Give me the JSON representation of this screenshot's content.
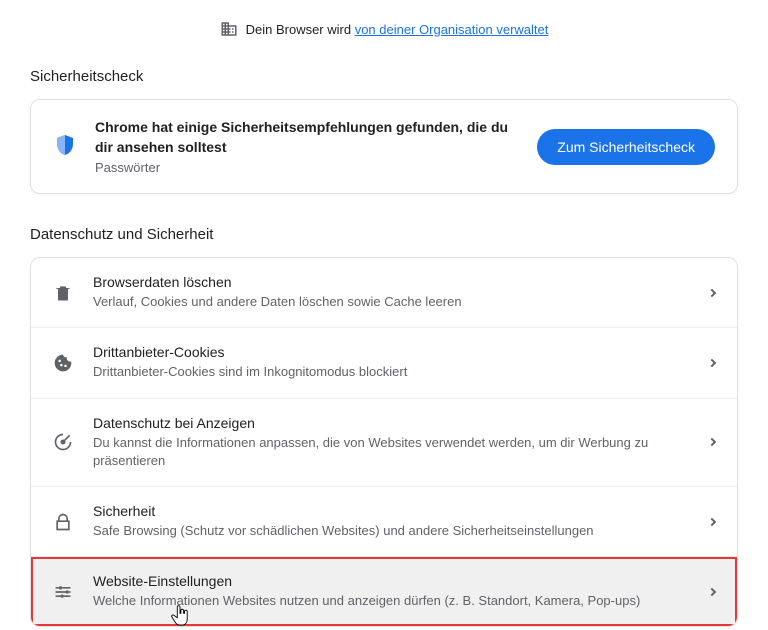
{
  "managed": {
    "prefix": "Dein Browser wird ",
    "link": "von deiner Organisation verwaltet"
  },
  "safety_section": {
    "title": "Sicherheitscheck",
    "card_title": "Chrome hat einige Sicherheitsempfehlungen gefunden, die du dir ansehen solltest",
    "card_sub": "Passwörter",
    "button": "Zum Sicherheitscheck"
  },
  "privacy_section": {
    "title": "Datenschutz und Sicherheit",
    "rows": [
      {
        "icon": "trash",
        "title": "Browserdaten löschen",
        "sub": "Verlauf, Cookies und andere Daten löschen sowie Cache leeren"
      },
      {
        "icon": "cookie",
        "title": "Drittanbieter-Cookies",
        "sub": "Drittanbieter-Cookies sind im Inkognitomodus blockiert"
      },
      {
        "icon": "adprivacy",
        "title": "Datenschutz bei Anzeigen",
        "sub": "Du kannst die Informationen anpassen, die von Websites verwendet werden, um dir Werbung zu präsentieren"
      },
      {
        "icon": "lock",
        "title": "Sicherheit",
        "sub": "Safe Browsing (Schutz vor schädlichen Websites) und andere Sicherheitseinstellungen"
      },
      {
        "icon": "sliders",
        "title": "Website-Einstellungen",
        "sub": "Welche Informationen Websites nutzen und anzeigen dürfen (z. B. Standort, Kamera, Pop-ups)"
      }
    ]
  }
}
